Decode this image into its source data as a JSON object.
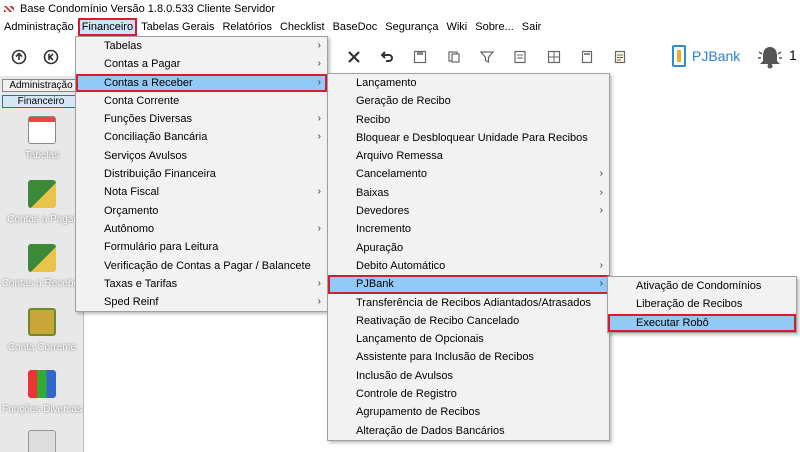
{
  "window": {
    "title": "Base Condomínio Versão 1.8.0.533 Cliente Servidor"
  },
  "menubar": [
    "Administração",
    "Financeiro",
    "Tabelas Gerais",
    "Relatórios",
    "Checklist",
    "BaseDoc",
    "Segurança",
    "Wiki",
    "Sobre...",
    "Sair"
  ],
  "toolbar": {
    "pjbank_label": "PJBank",
    "notification_count": "1"
  },
  "sidebar": {
    "tabs": [
      "Administração",
      "Financeiro"
    ],
    "items": [
      "Tabelas",
      "Contas a Pagar",
      "Contas a Receber",
      "Conta Corrente",
      "Funções Diversas"
    ]
  },
  "menu_financeiro": [
    {
      "label": "Tabelas",
      "submenu": true
    },
    {
      "label": "Contas a Pagar",
      "submenu": true
    },
    {
      "label": "Contas a Receber",
      "submenu": true
    },
    {
      "label": "Conta Corrente",
      "submenu": false
    },
    {
      "label": "Funções Diversas",
      "submenu": true
    },
    {
      "label": "Conciliação Bancária",
      "submenu": true
    },
    {
      "label": "Serviços Avulsos",
      "submenu": false
    },
    {
      "label": "Distribuição Financeira",
      "submenu": false
    },
    {
      "label": "Nota Fiscal",
      "submenu": true
    },
    {
      "label": "Orçamento",
      "submenu": false
    },
    {
      "label": "Autônomo",
      "submenu": true
    },
    {
      "label": "Formulário para Leitura",
      "submenu": false
    },
    {
      "label": "Verificação de Contas a Pagar / Balancete",
      "submenu": false
    },
    {
      "label": "Taxas e Tarifas",
      "submenu": true
    },
    {
      "label": "Sped Reinf",
      "submenu": true
    }
  ],
  "menu_contas_receber": [
    {
      "label": "Lançamento",
      "submenu": false
    },
    {
      "label": "Geração de Recibo",
      "submenu": false
    },
    {
      "label": "Recibo",
      "submenu": false
    },
    {
      "label": "Bloquear e Desbloquear Unidade Para Recibos",
      "submenu": false
    },
    {
      "label": "Arquivo Remessa",
      "submenu": false
    },
    {
      "label": "Cancelamento",
      "submenu": true
    },
    {
      "label": "Baixas",
      "submenu": true
    },
    {
      "label": "Devedores",
      "submenu": true
    },
    {
      "label": "Incremento",
      "submenu": false
    },
    {
      "label": "Apuração",
      "submenu": false
    },
    {
      "label": "Debito Automático",
      "submenu": true
    },
    {
      "label": "PJBank",
      "submenu": true
    },
    {
      "label": "Transferência de Recibos Adiantados/Atrasados",
      "submenu": false
    },
    {
      "label": "Reativação de Recibo Cancelado",
      "submenu": false
    },
    {
      "label": "Lançamento de Opcionais",
      "submenu": false
    },
    {
      "label": "Assistente para Inclusão de Recibos",
      "submenu": false
    },
    {
      "label": "Inclusão de Avulsos",
      "submenu": false
    },
    {
      "label": "Controle de Registro",
      "submenu": false
    },
    {
      "label": "Agrupamento de Recibos",
      "submenu": false
    },
    {
      "label": "Alteração de Dados Bancários",
      "submenu": false
    }
  ],
  "menu_pjbank": [
    {
      "label": "Ativação de Condomínios",
      "submenu": false
    },
    {
      "label": "Liberação de Recibos",
      "submenu": false
    },
    {
      "label": "Executar Robô",
      "submenu": false
    }
  ],
  "colors": {
    "highlight": "#91c9f7",
    "callout_border": "#d0202e",
    "menu_bg": "#f2f2f2",
    "pjbank_blue": "#2b7fd0"
  }
}
